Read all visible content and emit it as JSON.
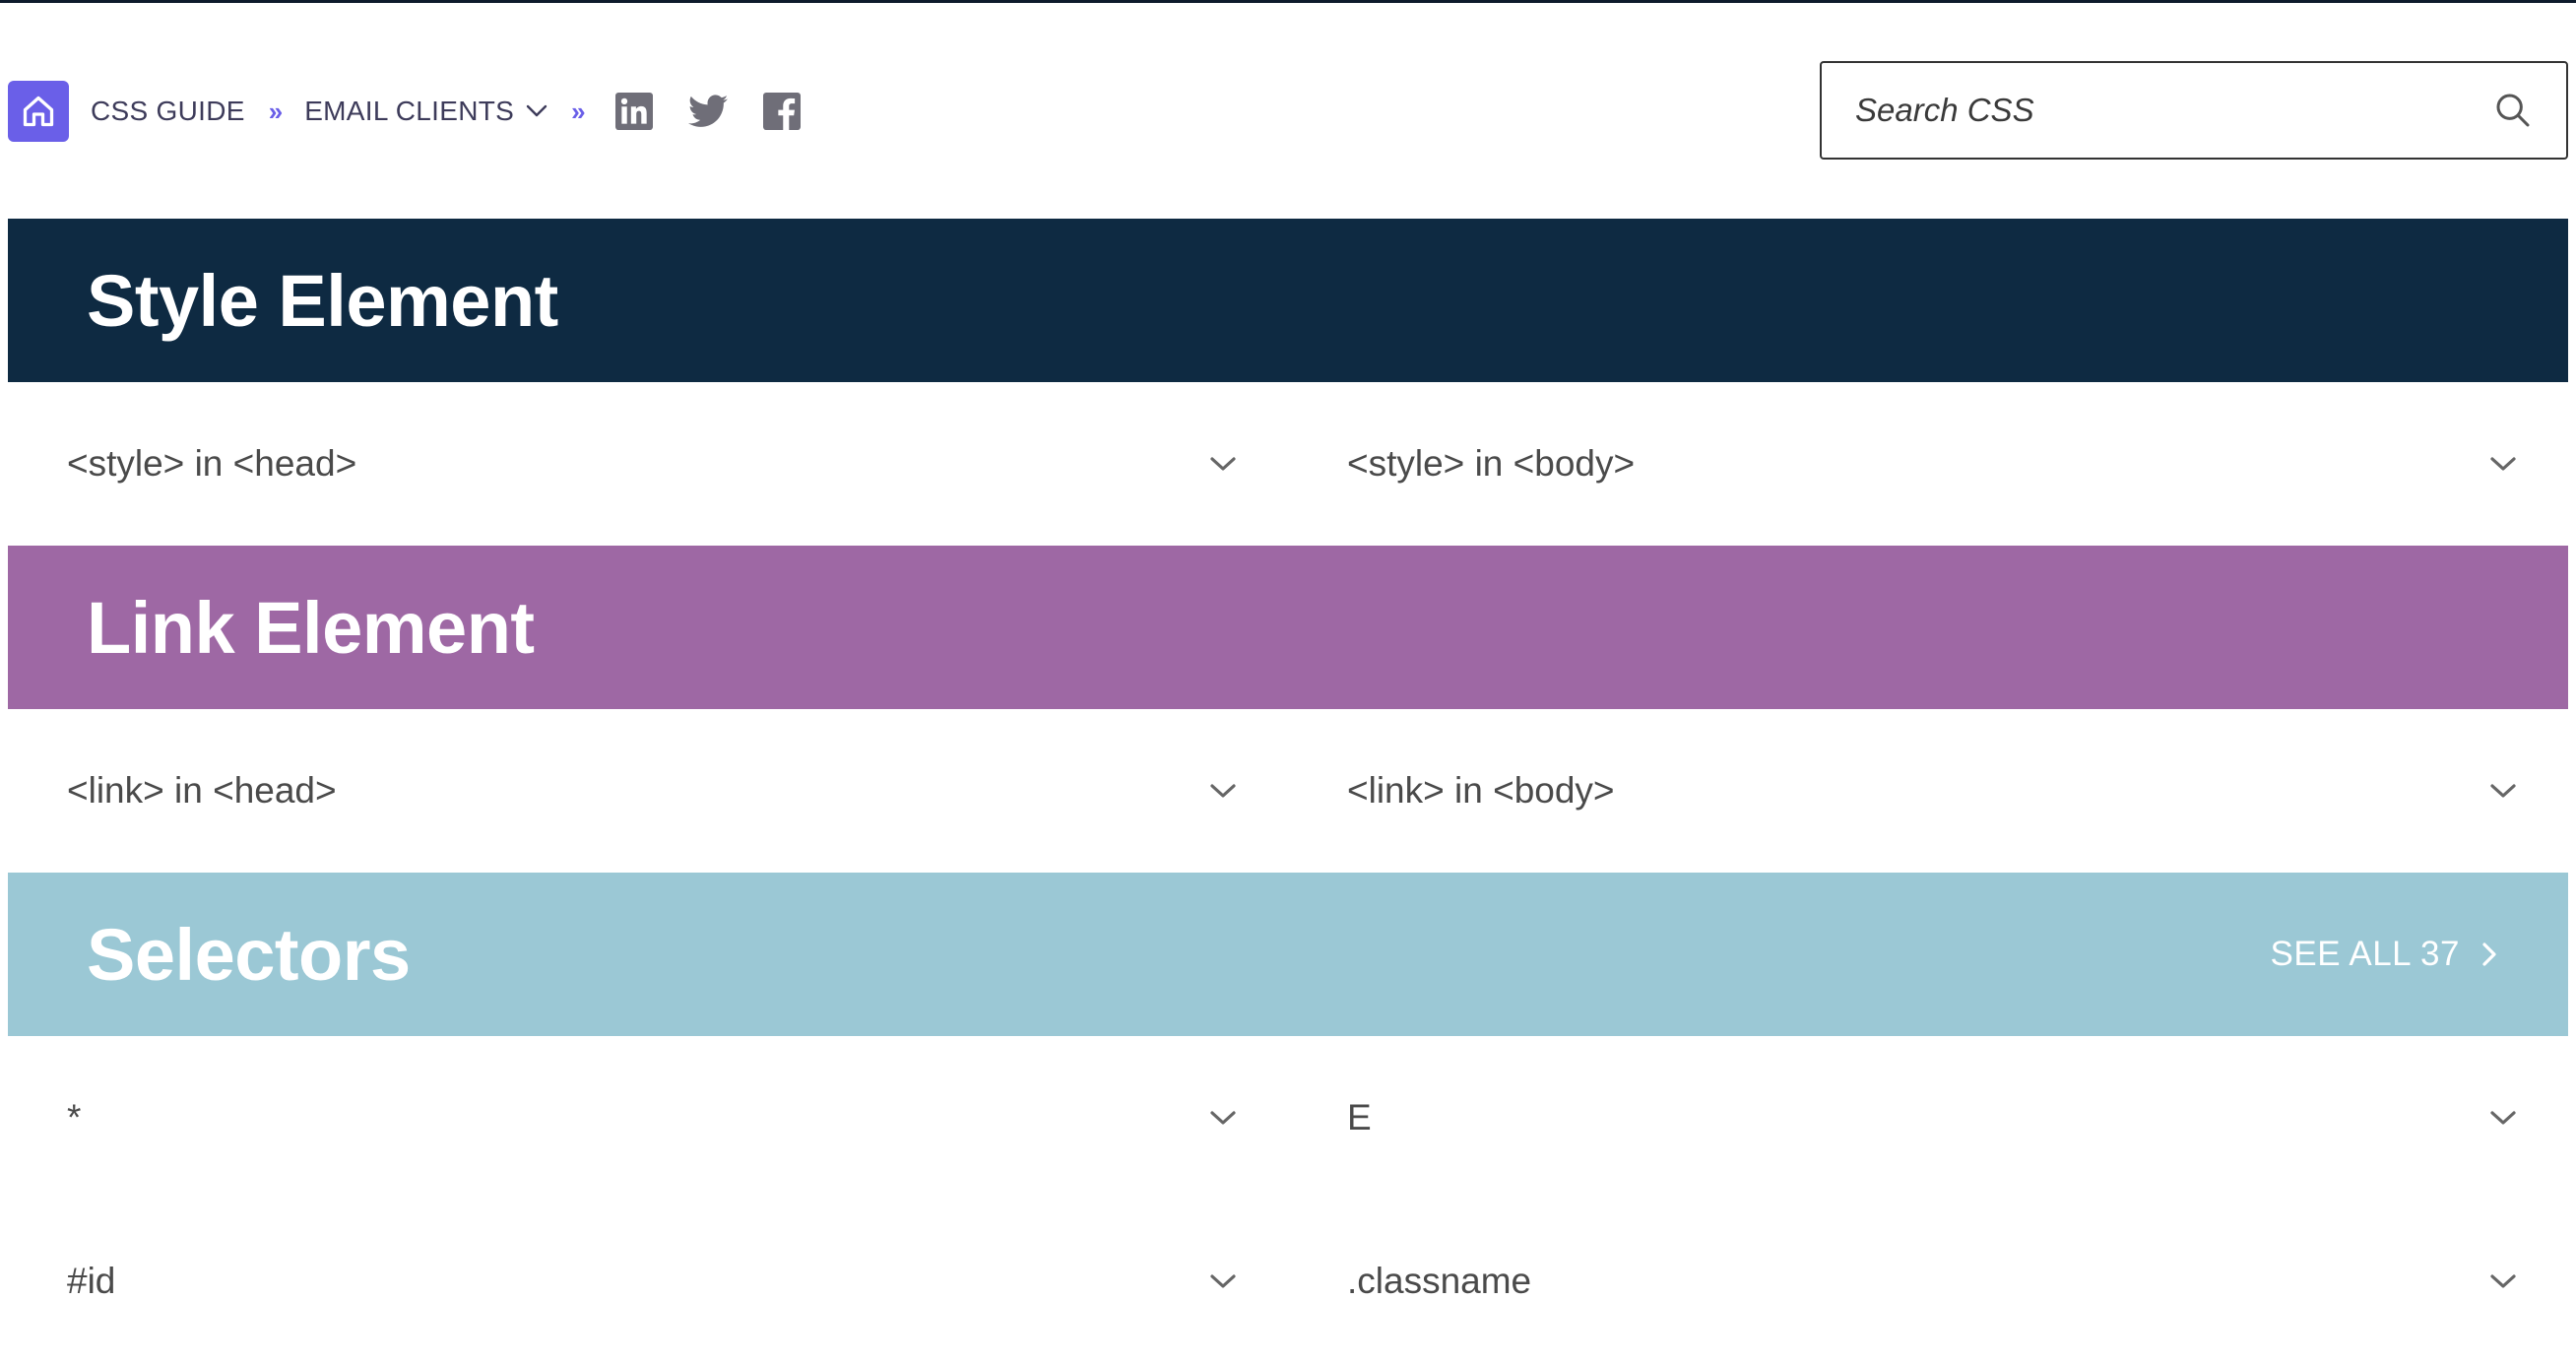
{
  "nav": {
    "home_label": "Home",
    "css_guide": "CSS GUIDE",
    "separator": "»",
    "email_clients": "EMAIL CLIENTS"
  },
  "search": {
    "placeholder": "Search CSS"
  },
  "sections": [
    {
      "title": "Style Element",
      "color": "#0e2a42",
      "items": [
        "<style> in <head>",
        "<style> in <body>"
      ]
    },
    {
      "title": "Link Element",
      "color": "#9e68a4",
      "items": [
        "<link> in <head>",
        "<link> in <body>"
      ]
    },
    {
      "title": "Selectors",
      "color": "#9bc8d5",
      "see_all": "SEE ALL 37",
      "items": [
        "*",
        "E",
        "#id",
        ".classname"
      ]
    }
  ],
  "icons": {
    "home": "home-icon",
    "linkedin": "linkedin-icon",
    "twitter": "twitter-icon",
    "facebook": "facebook-icon",
    "search": "search-icon",
    "chevron": "chevron-down-icon"
  }
}
